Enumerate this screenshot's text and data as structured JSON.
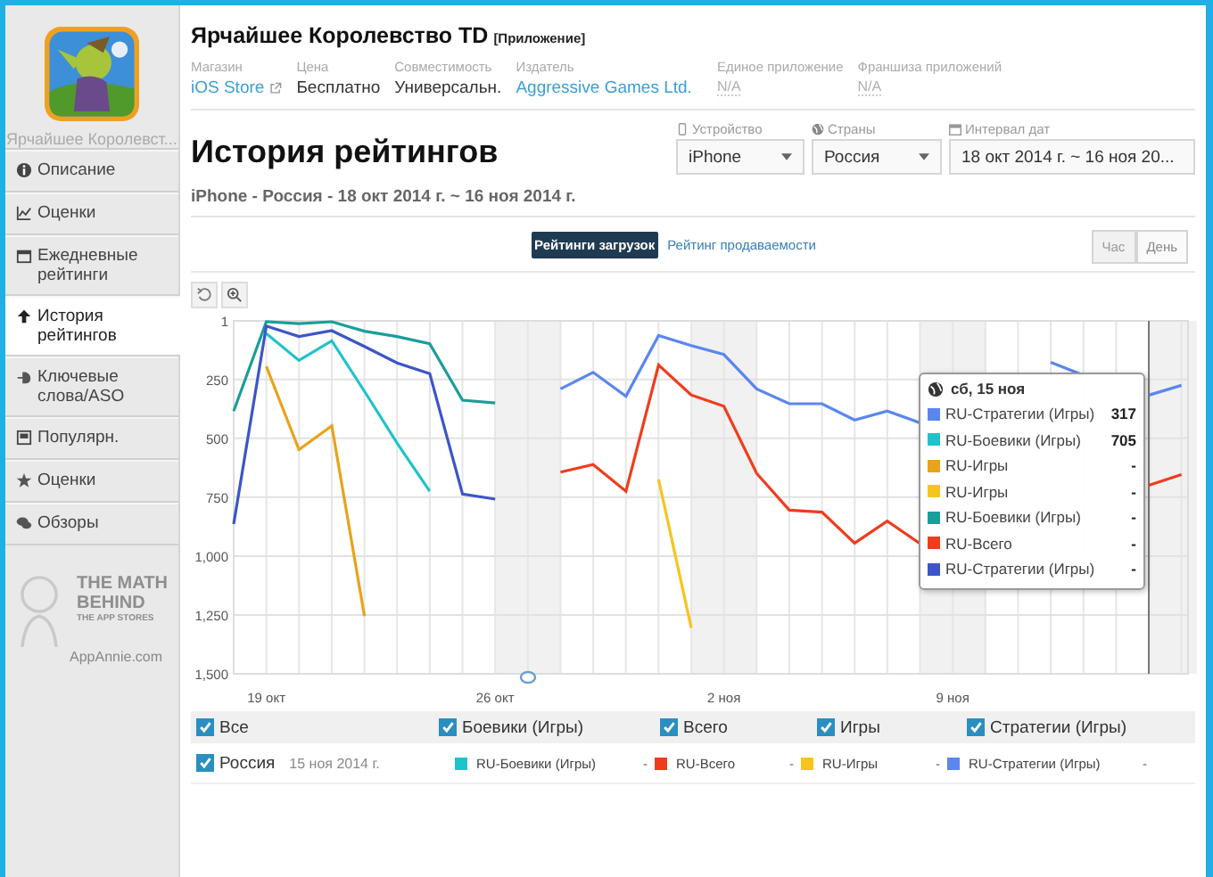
{
  "sidebar": {
    "app_name": "Ярчайшее Королевст...",
    "items": [
      {
        "label": "Описание",
        "selected": false
      },
      {
        "label": "Оценки",
        "selected": false
      },
      {
        "label": "Ежедневные рейтинги",
        "selected": false
      },
      {
        "label": "История рейтингов",
        "selected": true
      },
      {
        "label": "Ключевые слова/ASO",
        "selected": false
      },
      {
        "label": "Популярн.",
        "selected": false
      },
      {
        "label": "Оценки",
        "selected": false
      },
      {
        "label": "Обзоры",
        "selected": false
      }
    ],
    "promo": {
      "lines": [
        "THE MATH",
        "BEHIND",
        "THE APP STORES"
      ],
      "site": "AppAnnie.com"
    }
  },
  "header": {
    "title": "Ярчайшее Королевство TD",
    "tag": "[Приложение]",
    "meta": [
      {
        "label": "Магазин",
        "value": "iOS Store",
        "kind": "link"
      },
      {
        "label": "Цена",
        "value": "Бесплатно",
        "kind": "plain"
      },
      {
        "label": "Совместимость",
        "value": "Универсальн.",
        "kind": "plain"
      },
      {
        "label": "Издатель",
        "value": "Aggressive Games Ltd.",
        "kind": "link"
      },
      {
        "label": "Единое приложение",
        "value": "N/A",
        "kind": "muted"
      },
      {
        "label": "Франшиза приложений",
        "value": "N/A",
        "kind": "muted"
      }
    ]
  },
  "page": {
    "title": "История рейтингов",
    "subtitle": "iPhone - Россия - 18 окт 2014 г. ~ 16 ноя 2014 г.",
    "filters": [
      {
        "label": "Устройство",
        "value": "iPhone"
      },
      {
        "label": "Страны",
        "value": "Россия"
      },
      {
        "label": "Интервал дат",
        "value": "18 окт 2014 г. ~ 16 ноя 20..."
      }
    ]
  },
  "chart_tabs": [
    {
      "label": "Рейтинги загрузок",
      "selected": true
    },
    {
      "label": "Рейтинг продаваемости",
      "selected": false
    }
  ],
  "granularity": [
    {
      "label": "Час",
      "selected": false
    },
    {
      "label": "День",
      "selected": true
    }
  ],
  "chart_data": {
    "type": "line",
    "categories": [
      null,
      "19 окт",
      null,
      null,
      null,
      null,
      null,
      null,
      "26 окт",
      null,
      null,
      null,
      null,
      null,
      null,
      "2 ноя",
      null,
      null,
      null,
      null,
      null,
      null,
      "9 ноя",
      null,
      null,
      null,
      null,
      null,
      null,
      null
    ],
    "ylim": [
      1500,
      1
    ],
    "grid": true,
    "legend": true,
    "yticks": [
      {
        "value": 1,
        "label": "1"
      },
      {
        "value": 250,
        "label": "250"
      },
      {
        "value": 500,
        "label": "500"
      },
      {
        "value": 750,
        "label": "750"
      },
      {
        "value": 1000,
        "label": "1,000"
      },
      {
        "value": 1250,
        "label": "1,250"
      },
      {
        "value": 1500,
        "label": "1,500"
      }
    ],
    "series": [
      {
        "name": "RU-Стратегии (Игры)",
        "color": "#5b86f0",
        "values": [
          null,
          null,
          null,
          null,
          null,
          null,
          null,
          null,
          null,
          null,
          290,
          220,
          321,
          63,
          106,
          144,
          290,
          353,
          353,
          422,
          384,
          434,
          null,
          null,
          null,
          177,
          232,
          null,
          317,
          275
        ]
      },
      {
        "name": "RU-Боевики (Игры)",
        "color": "#1fc3cc",
        "values": [
          null,
          55,
          169,
          86,
          300,
          520,
          725,
          null,
          null,
          null,
          null,
          null,
          null,
          null,
          null,
          null,
          null,
          null,
          null,
          null,
          null,
          null,
          null,
          null,
          null,
          null,
          null,
          null,
          null,
          null
        ]
      },
      {
        "name": "RU-Игры",
        "color": "#e8a31a",
        "values": [
          null,
          195,
          548,
          447,
          1255,
          null,
          null,
          null,
          null,
          null,
          null,
          null,
          null,
          null,
          null,
          null,
          null,
          null,
          null,
          null,
          null,
          null,
          null,
          null,
          null,
          null,
          null,
          null,
          null,
          null
        ]
      },
      {
        "name": "RU-Игры",
        "color": "#f7c41f",
        "values": [
          null,
          null,
          null,
          null,
          null,
          null,
          null,
          null,
          null,
          null,
          null,
          null,
          null,
          674,
          1305,
          null,
          null,
          null,
          null,
          null,
          null,
          null,
          null,
          null,
          null,
          null,
          null,
          null,
          null,
          null
        ]
      },
      {
        "name": "RU-Боевики (Игры)",
        "color": "#1a9e9a",
        "values": [
          384,
          5,
          13,
          5,
          45,
          68,
          98,
          338,
          350,
          null,
          null,
          null,
          null,
          null,
          null,
          null,
          null,
          null,
          null,
          null,
          null,
          null,
          null,
          null,
          null,
          null,
          null,
          null,
          null,
          null
        ]
      },
      {
        "name": "RU-Всего",
        "color": "#f03c1e",
        "values": [
          null,
          null,
          null,
          null,
          null,
          null,
          null,
          null,
          null,
          null,
          644,
          611,
          725,
          189,
          316,
          364,
          649,
          805,
          813,
          945,
          851,
          947,
          null,
          null,
          null,
          null,
          null,
          null,
          699,
          654
        ]
      },
      {
        "name": "RU-Стратегии (Игры)",
        "color": "#3c55c8",
        "values": [
          864,
          23,
          68,
          43,
          110,
          180,
          225,
          737,
          758,
          null,
          null,
          null,
          null,
          null,
          null,
          null,
          null,
          null,
          null,
          null,
          null,
          null,
          null,
          null,
          null,
          null,
          null,
          null,
          null,
          null
        ]
      }
    ]
  },
  "tooltip": {
    "title": "сб, 15 ноя",
    "values": [
      "317",
      "705",
      "-",
      "-",
      "-",
      "-",
      "-"
    ]
  },
  "legend": {
    "groups": [
      {
        "label": "Все",
        "checked": true
      },
      {
        "label": "Боевики (Игры)",
        "checked": true
      },
      {
        "label": "Всего",
        "checked": true
      },
      {
        "label": "Игры",
        "checked": true
      },
      {
        "label": "Стратегии (Игры)",
        "checked": true
      }
    ],
    "rows": [
      {
        "label": "Россия",
        "checked": true,
        "date": "15 ноя 2014 г.",
        "items": [
          {
            "label": "RU-Боевики (Игры)",
            "value": "-",
            "color": "#1fc3cc"
          },
          {
            "label": "RU-Всего",
            "value": "-",
            "color": "#f03c1e"
          },
          {
            "label": "RU-Игры",
            "value": "-",
            "color": "#f7c41f"
          },
          {
            "label": "RU-Стратегии (Игры)",
            "value": "-",
            "color": "#5b86f0"
          }
        ]
      }
    ]
  }
}
